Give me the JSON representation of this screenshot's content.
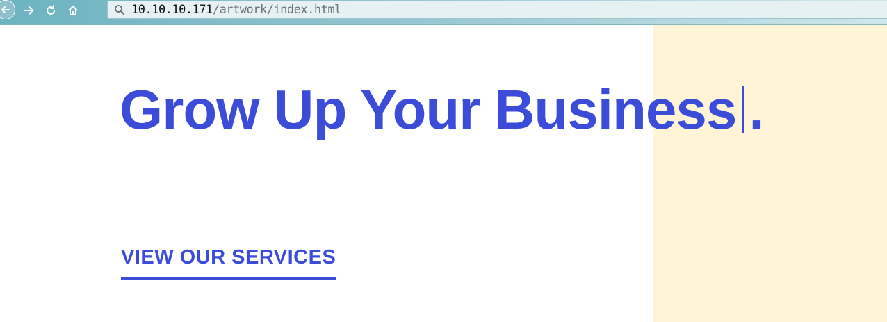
{
  "browser": {
    "url_host": "10.10.10.171",
    "url_path": "/artwork/index.html",
    "icons": {
      "back": "arrow-left-icon",
      "forward": "arrow-right-icon",
      "reload": "reload-icon",
      "home": "home-icon",
      "search": "search-icon"
    }
  },
  "hero": {
    "title": "Grow Up Your Business",
    "title_suffix": ".",
    "cta_label": "VIEW OUR SERVICES"
  },
  "colors": {
    "brand_blue": "#3b4cd8",
    "accent_panel": "#fff5d6",
    "toolbar": "#6cb3c0"
  }
}
